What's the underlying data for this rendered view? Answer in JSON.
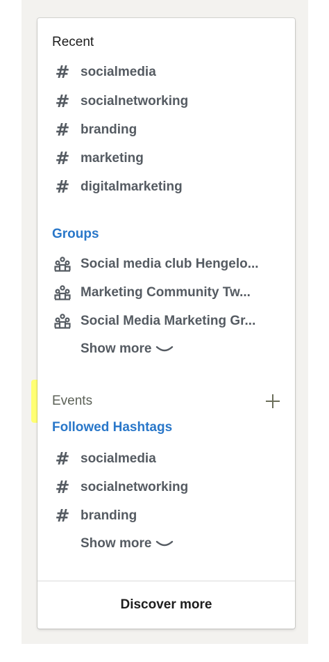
{
  "recent": {
    "title": "Recent",
    "items": [
      {
        "label": "socialmedia",
        "icon": "hashtag-icon"
      },
      {
        "label": "socialnetworking",
        "icon": "hashtag-icon"
      },
      {
        "label": "branding",
        "icon": "hashtag-icon"
      },
      {
        "label": "marketing",
        "icon": "hashtag-icon"
      },
      {
        "label": "digitalmarketing",
        "icon": "hashtag-icon"
      }
    ]
  },
  "groups": {
    "title": "Groups",
    "items": [
      {
        "label": "Social media club Hengelo...",
        "icon": "group-icon"
      },
      {
        "label": "Marketing Community Tw...",
        "icon": "group-icon"
      },
      {
        "label": "Social Media Marketing Gr...",
        "icon": "group-icon"
      }
    ],
    "show_more": "Show more"
  },
  "events": {
    "title": "Events",
    "highlight_color": "#ffff73"
  },
  "followed_hashtags": {
    "title": "Followed Hashtags",
    "items": [
      {
        "label": "socialmedia",
        "icon": "hashtag-icon"
      },
      {
        "label": "socialnetworking",
        "icon": "hashtag-icon"
      },
      {
        "label": "branding",
        "icon": "hashtag-icon"
      }
    ],
    "show_more": "Show more"
  },
  "footer": {
    "discover_label": "Discover more"
  },
  "colors": {
    "link": "#2977c9",
    "text": "#555b62",
    "background": "#f3f2ef"
  }
}
